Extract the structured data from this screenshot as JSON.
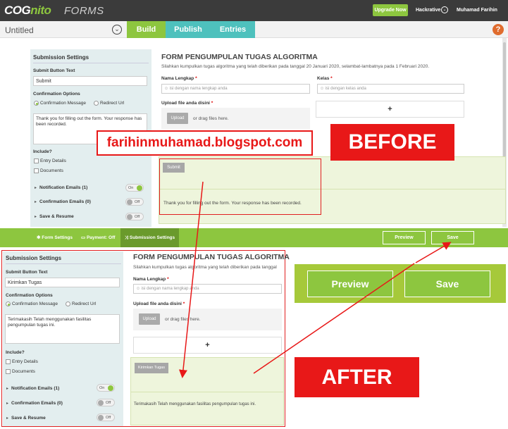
{
  "header": {
    "logo_cog": "COG",
    "logo_nito": "nito",
    "logo_forms": "FORMS",
    "upgrade": "Upgrade Now",
    "org": "Hackrative",
    "user": "Muhamad Farihin"
  },
  "bar2": {
    "title": "Untitled",
    "tabs": [
      "Build",
      "Publish",
      "Entries"
    ],
    "help": "?"
  },
  "before": {
    "settings": {
      "title": "Submission Settings",
      "submit_label": "Submit Button Text",
      "submit_value": "Submit",
      "confirm_options": "Confirmation Options",
      "opt_message": "Confirmation Message",
      "opt_redirect": "Redirect Url",
      "message": "Thank you for filling out the form. Your response has been recorded.",
      "include": "Include?",
      "entry_details": "Entry Details",
      "documents": "Documents",
      "notif": "Notification Emails (1)",
      "notif_toggle": "On",
      "confirm_emails": "Confirmation Emails (0)",
      "confirm_toggle": "Off",
      "save_resume": "Save & Resume",
      "save_toggle": "Off"
    },
    "form": {
      "title": "FORM PENGUMPULAN TUGAS ALGORITMA",
      "desc": "Silahkan kumpulkan tugas algoritma yang telah diberikan pada tanggal 20 Januari 2020, selambat-lambatnya pada 1 Februari 2020.",
      "name_label": "Nama Lengkap",
      "name_ph": "isi dengan nama lengkap anda",
      "class_label": "Kelas",
      "class_ph": "isi dengan kelas anda",
      "upload_label": "Upload file anda disini",
      "upload_btn": "Upload",
      "drag": "or drag files here.",
      "plus": "+",
      "submit_btn": "Submit",
      "confirm_text": "Thank you for filling out the form. Your response has been recorded."
    }
  },
  "toolbar": {
    "form_settings": "Form Settings",
    "payment": "Payment: Off",
    "submission_settings": "Submission Settings",
    "preview": "Preview",
    "save": "Save"
  },
  "after": {
    "settings": {
      "title": "Submission Settings",
      "submit_label": "Submit Button Text",
      "submit_value": "Kirimkan Tugas",
      "confirm_options": "Confirmation Options",
      "opt_message": "Confirmation Message",
      "opt_redirect": "Redirect Url",
      "message": "Terimakasih Telah menggunakan fasilitas pengumpulan tugas ini.",
      "include": "Include?",
      "entry_details": "Entry Details",
      "documents": "Documents",
      "notif": "Notification Emails (1)",
      "notif_toggle": "On",
      "confirm_emails": "Confirmation Emails (0)",
      "confirm_toggle": "Off",
      "save_resume": "Save & Resume",
      "save_toggle": "Off"
    },
    "form": {
      "title": "FORM PENGUMPULAN TUGAS ALGORITMA",
      "desc": "Silahkan kumpulkan tugas algoritma yang telah diberikan pada tanggal",
      "name_label": "Nama Lengkap",
      "name_ph": "isi dengan nama lengkap anda",
      "upload_label": "Upload file anda disini",
      "upload_btn": "Upload",
      "drag": "or drag files here.",
      "plus": "+",
      "submit_btn": "Kirimkan Tugas",
      "confirm_text": "Terimakasih Telah menggunakan fasilitas pengumpulan tugas ini."
    }
  },
  "zoom": {
    "preview": "Preview",
    "save": "Save"
  },
  "annotations": {
    "watermark": "farihinmuhamad.blogspot.com",
    "before": "BEFORE",
    "after": "AFTER"
  },
  "colors": {
    "green": "#8dc63f",
    "teal": "#4ec1bd",
    "red": "#e81818",
    "dark": "#3b3b3b"
  }
}
